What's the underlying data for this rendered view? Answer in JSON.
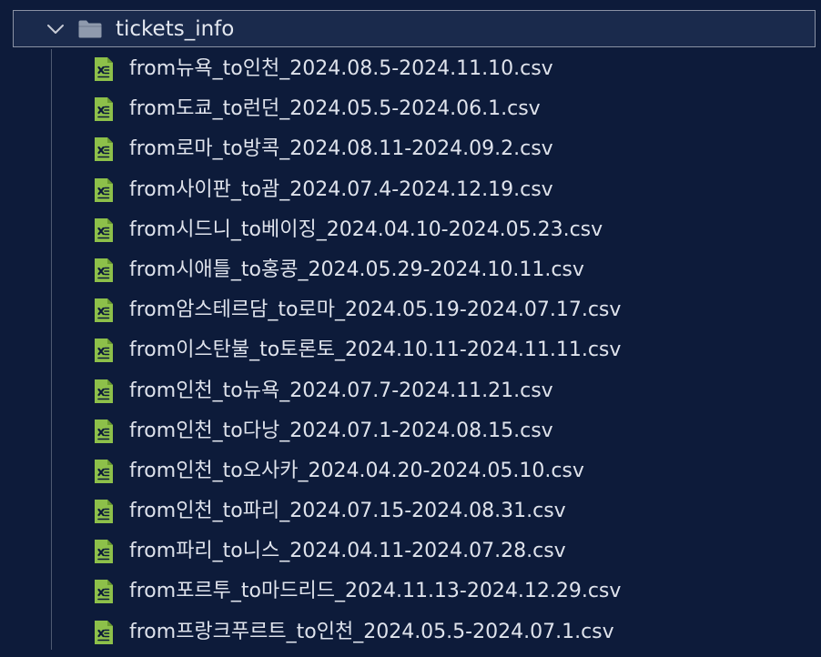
{
  "colors": {
    "background": "#0d1b3a",
    "selection_background": "#1a2a4c",
    "selection_border": "#8a92a4",
    "csv_icon": "#8dc04a",
    "text": "#dfe3ec"
  },
  "folder": {
    "name": "tickets_info",
    "expanded": true,
    "chevron_icon": "chevron-down-icon",
    "icon": "folder-open-icon"
  },
  "files": [
    {
      "name": "from뉴욕_to인천_2024.08.5-2024.11.10.csv",
      "icon": "csv-file-icon"
    },
    {
      "name": "from도쿄_to런던_2024.05.5-2024.06.1.csv",
      "icon": "csv-file-icon"
    },
    {
      "name": "from로마_to방콕_2024.08.11-2024.09.2.csv",
      "icon": "csv-file-icon"
    },
    {
      "name": "from사이판_to괌_2024.07.4-2024.12.19.csv",
      "icon": "csv-file-icon"
    },
    {
      "name": "from시드니_to베이징_2024.04.10-2024.05.23.csv",
      "icon": "csv-file-icon"
    },
    {
      "name": "from시애틀_to홍콩_2024.05.29-2024.10.11.csv",
      "icon": "csv-file-icon"
    },
    {
      "name": "from암스테르담_to로마_2024.05.19-2024.07.17.csv",
      "icon": "csv-file-icon"
    },
    {
      "name": "from이스탄불_to토론토_2024.10.11-2024.11.11.csv",
      "icon": "csv-file-icon"
    },
    {
      "name": "from인천_to뉴욕_2024.07.7-2024.11.21.csv",
      "icon": "csv-file-icon"
    },
    {
      "name": "from인천_to다낭_2024.07.1-2024.08.15.csv",
      "icon": "csv-file-icon"
    },
    {
      "name": "from인천_to오사카_2024.04.20-2024.05.10.csv",
      "icon": "csv-file-icon"
    },
    {
      "name": "from인천_to파리_2024.07.15-2024.08.31.csv",
      "icon": "csv-file-icon"
    },
    {
      "name": "from파리_to니스_2024.04.11-2024.07.28.csv",
      "icon": "csv-file-icon"
    },
    {
      "name": "from포르투_to마드리드_2024.11.13-2024.12.29.csv",
      "icon": "csv-file-icon"
    },
    {
      "name": "from프랑크푸르트_to인천_2024.05.5-2024.07.1.csv",
      "icon": "csv-file-icon"
    }
  ]
}
